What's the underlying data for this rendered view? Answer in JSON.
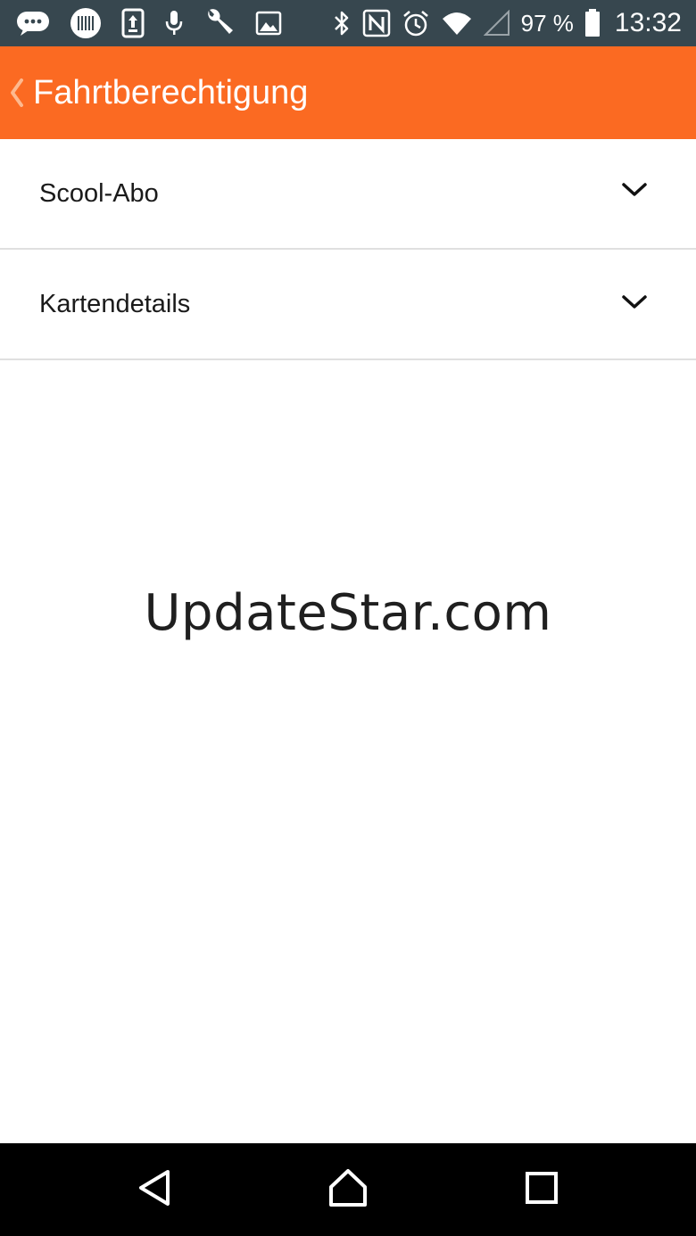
{
  "status_bar": {
    "battery": "97 %",
    "time": "13:32",
    "left_icons": [
      "chat-icon",
      "barcode-icon",
      "sync-icon",
      "microphone-icon",
      "wrench-icon",
      "image-icon"
    ],
    "right_icons": [
      "bluetooth-icon",
      "nfc-icon",
      "alarm-icon",
      "wifi-icon",
      "cellular-signal-icon",
      "battery-icon"
    ]
  },
  "app_bar": {
    "title": "Fahrtberechtigung",
    "background_color": "#fb6a22"
  },
  "sections": [
    {
      "label": "Scool-Abo",
      "expanded": false
    },
    {
      "label": "Kartendetails",
      "expanded": false
    }
  ],
  "watermark": "UpdateStar.com",
  "nav_bar": {
    "buttons": [
      "back-icon",
      "home-icon",
      "recents-icon"
    ]
  }
}
